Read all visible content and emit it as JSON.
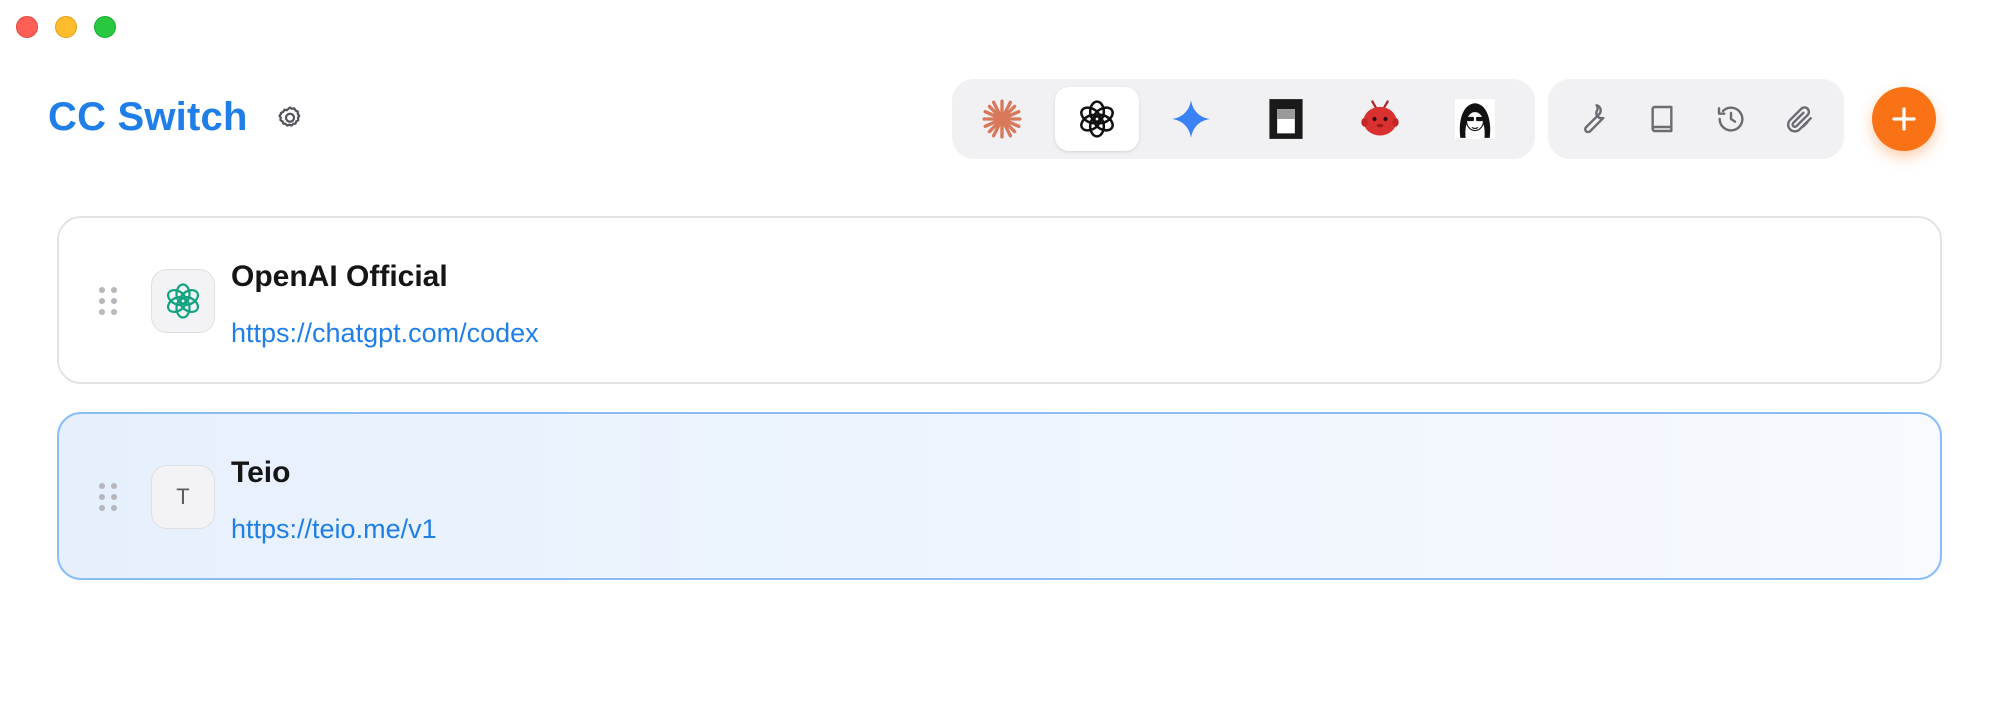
{
  "window": {
    "controls": [
      "close",
      "minimize",
      "maximize"
    ]
  },
  "header": {
    "title": "CC Switch",
    "settings_icon": "gear-icon",
    "app_tabs": [
      {
        "name": "claude",
        "icon": "claude-sunburst-icon",
        "active": false
      },
      {
        "name": "codex",
        "icon": "openai-knot-icon",
        "active": true
      },
      {
        "name": "gemini",
        "icon": "gemini-sparkle-icon",
        "active": false
      },
      {
        "name": "terminal",
        "icon": "terminal-block-icon",
        "active": false
      },
      {
        "name": "red-mascot",
        "icon": "red-mascot-icon",
        "active": false
      },
      {
        "name": "avatar-girl",
        "icon": "anime-girl-icon",
        "active": false
      }
    ],
    "tools": [
      {
        "name": "wrench",
        "icon": "wrench-icon"
      },
      {
        "name": "book",
        "icon": "book-icon"
      },
      {
        "name": "history",
        "icon": "history-icon"
      },
      {
        "name": "paperclip",
        "icon": "paperclip-icon"
      }
    ],
    "add_icon": "plus-icon"
  },
  "providers": [
    {
      "name": "OpenAI Official",
      "url": "https://chatgpt.com/codex",
      "icon": "openai-knot-icon",
      "selected": false
    },
    {
      "name": "Teio",
      "url": "https://teio.me/v1",
      "icon_letter": "T",
      "selected": true
    }
  ],
  "colors": {
    "brand_blue": "#1f7ee8",
    "add_orange": "#f97316",
    "selected_border": "#8bbdf5",
    "selected_bg": "#e6f0fd"
  }
}
